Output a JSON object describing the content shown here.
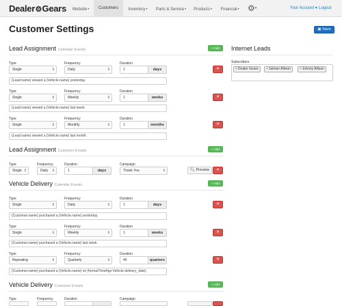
{
  "navbar": {
    "brand_left": "Dealer",
    "brand_right": "Gears",
    "items": [
      {
        "label": "Website",
        "caret": "▾"
      },
      {
        "label": "Customers",
        "caret": ""
      },
      {
        "label": "Inventory",
        "caret": "▾"
      },
      {
        "label": "Parts & Service",
        "caret": "▾"
      },
      {
        "label": "Products",
        "caret": "▾"
      },
      {
        "label": "Financial",
        "caret": "▾"
      }
    ],
    "account": "Your Account ▾",
    "logout": "Logout"
  },
  "page": {
    "title": "Customer Settings",
    "save_label": "Save"
  },
  "sections": {
    "lead_calendar": {
      "title": "Lead Assignment",
      "subtitle": "Calendar Events",
      "add": "+ Add"
    },
    "lead_email": {
      "title": "Lead Assignment",
      "subtitle": "Customer Emails",
      "add": "+ Add"
    },
    "vehicle_calendar": {
      "title": "Vehicle Delivery",
      "subtitle": "Calendar Events",
      "add": "+ Add"
    },
    "vehicle_email": {
      "title": "Vehicle Delivery",
      "subtitle": "Customer Emails",
      "add": "+ Add"
    }
  },
  "labels": {
    "type": "Type",
    "frequency": "Frequency",
    "duration": "Duration",
    "campaign": "Campaign",
    "preview": "Preview",
    "delete": "×"
  },
  "lead_calendar_rows": [
    {
      "type": "Single",
      "frequency": "Daily",
      "duration": "1",
      "unit": "days",
      "message": "{Lead.name} viewed a {Vehicle.name} yesterday."
    },
    {
      "type": "Single",
      "frequency": "Weekly",
      "duration": "1",
      "unit": "weeks",
      "message": "{Lead.name} viewed a {Vehicle.name} last week."
    },
    {
      "type": "Single",
      "frequency": "Monthly",
      "duration": "1",
      "unit": "months",
      "message": "{Lead.name} viewed a {Vehicle.name} last month."
    }
  ],
  "lead_email_rows": [
    {
      "type": "Single",
      "frequency": "Daily",
      "duration": "1",
      "unit": "days",
      "campaign": "Thank You"
    }
  ],
  "vehicle_calendar_rows": [
    {
      "type": "Single",
      "frequency": "Daily",
      "duration": "1",
      "unit": "days",
      "message": "{Customer.name} purchased a {Vehicle.name} yesterday."
    },
    {
      "type": "Single",
      "frequency": "Weekly",
      "duration": "1",
      "unit": "weeks",
      "message": "{Customer.name} purchased a {Vehicle.name} last week."
    },
    {
      "type": "Repeating",
      "frequency": "Quarterly",
      "duration": "40",
      "unit": "quarters",
      "message": "{Customer.name} purchased a {Vehicle.name} on {formatTimeAgo:Vehicle.delivery_date}."
    }
  ],
  "internet_leads": {
    "title": "Internet Leads",
    "subscribers_label": "Subscribers",
    "subscribers": [
      "Dealer Gears",
      "Jaimen Allison",
      "Johnny Allison"
    ]
  }
}
